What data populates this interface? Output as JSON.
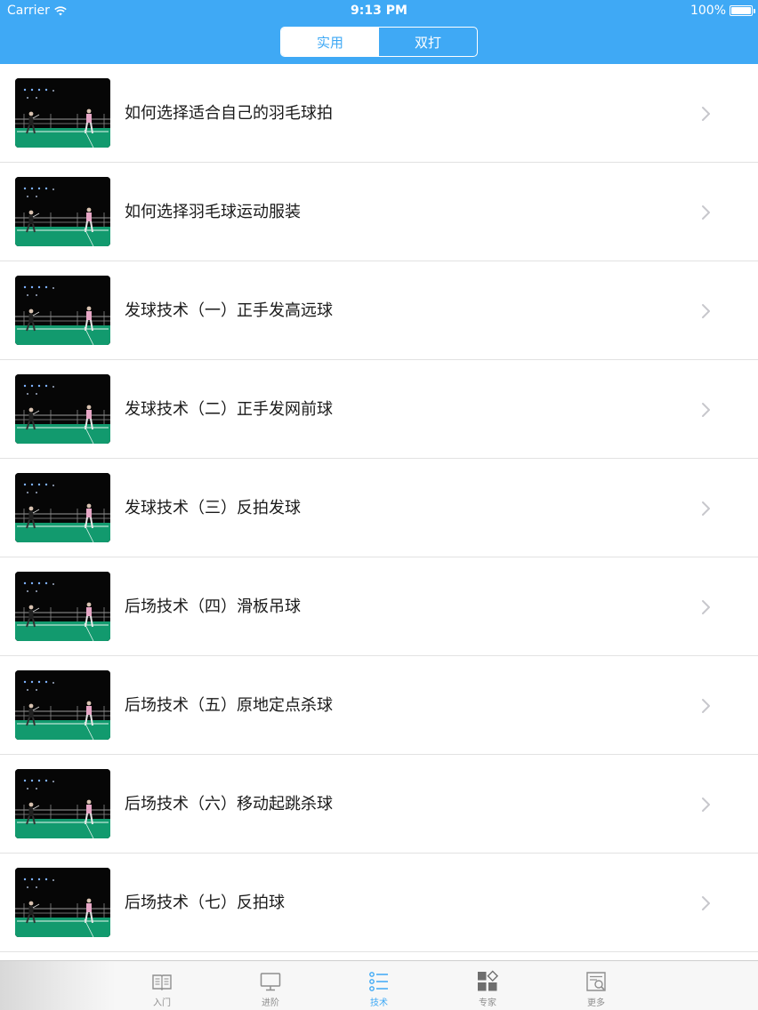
{
  "status_bar": {
    "carrier": "Carrier",
    "time": "9:13 PM",
    "battery": "100%"
  },
  "segmented": {
    "left_label": "实用",
    "right_label": "双打",
    "selected": "实用"
  },
  "list": {
    "items": [
      {
        "title": "如何选择适合自己的羽毛球拍"
      },
      {
        "title": "如何选择羽毛球运动服装"
      },
      {
        "title": "发球技术（一）正手发高远球"
      },
      {
        "title": "发球技术（二）正手发网前球"
      },
      {
        "title": "发球技术（三）反拍发球"
      },
      {
        "title": "后场技术（四）滑板吊球"
      },
      {
        "title": "后场技术（五）原地定点杀球"
      },
      {
        "title": "后场技术（六）移动起跳杀球"
      },
      {
        "title": "后场技术（七）反拍球"
      }
    ]
  },
  "tabbar": {
    "tabs": [
      {
        "label": "入门",
        "icon": "book-icon"
      },
      {
        "label": "进阶",
        "icon": "monitor-icon"
      },
      {
        "label": "技术",
        "icon": "list-icon"
      },
      {
        "label": "专家",
        "icon": "grid-icon"
      },
      {
        "label": "更多",
        "icon": "document-icon"
      }
    ],
    "active": "技术"
  },
  "colors": {
    "accent": "#3fa9f5",
    "court_green": "#129a6e",
    "tab_inactive": "#8e8e8e"
  }
}
